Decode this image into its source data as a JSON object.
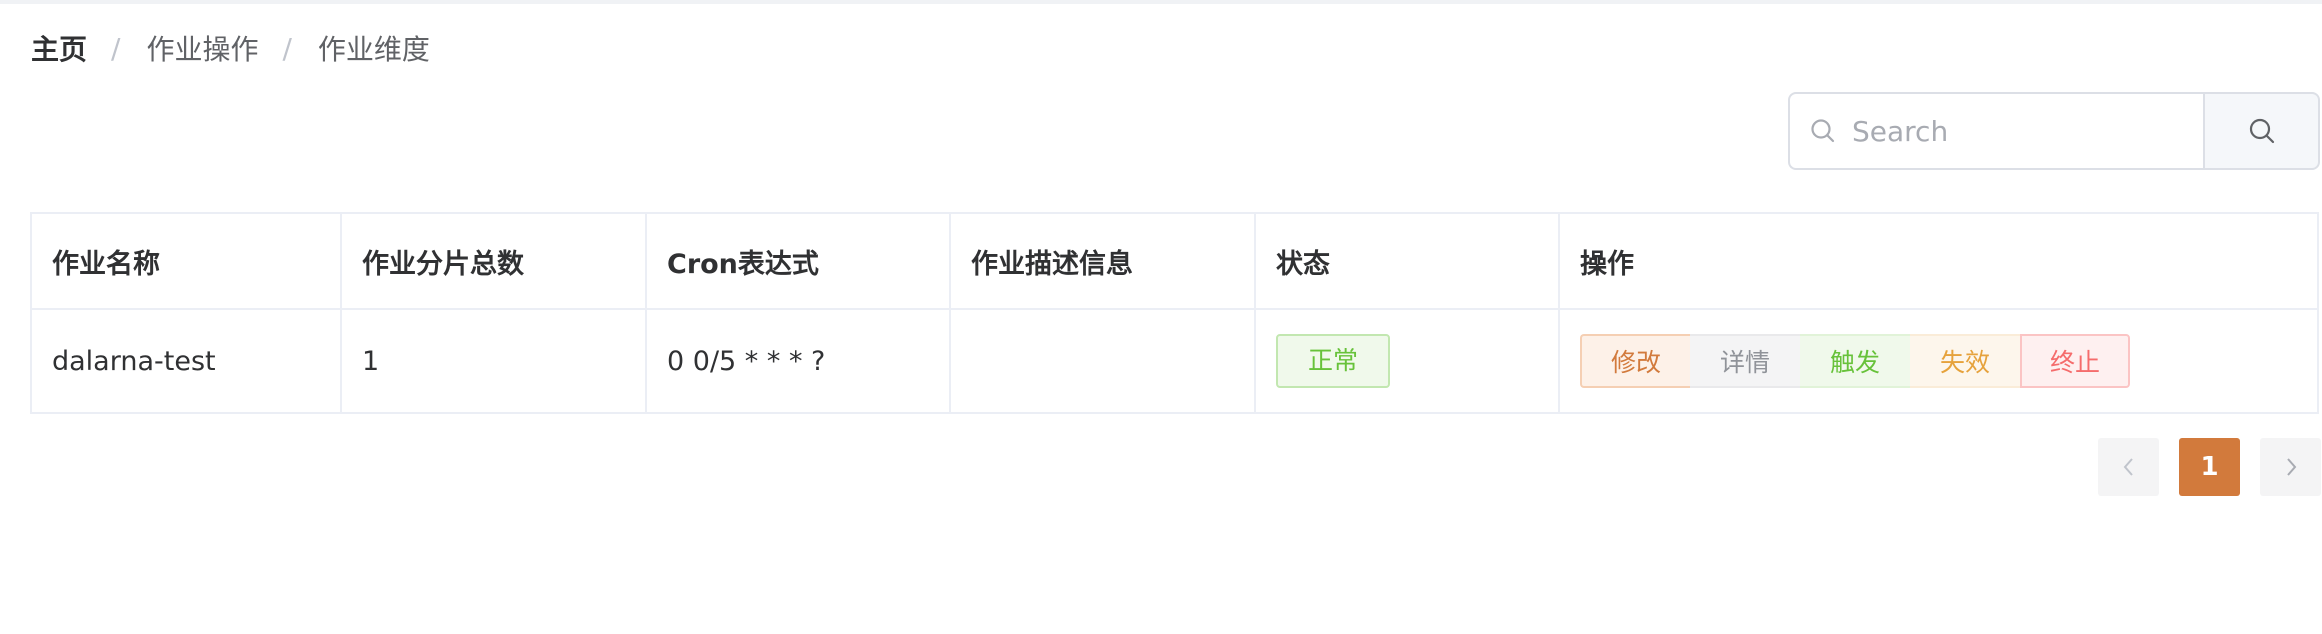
{
  "breadcrumb": {
    "items": [
      "主页",
      "作业操作",
      "作业维度"
    ],
    "separator": "/"
  },
  "search": {
    "placeholder": "Search",
    "value": "",
    "icon": "search-icon",
    "button_icon": "search-icon"
  },
  "table": {
    "columns": [
      "作业名称",
      "作业分片总数",
      "Cron表达式",
      "作业描述信息",
      "状态",
      "操作"
    ],
    "rows": [
      {
        "name": "dalarna-test",
        "sharding": "1",
        "cron": "0 0/5 * * * ?",
        "description": "",
        "status": "正常",
        "actions": [
          "修改",
          "详情",
          "触发",
          "失效",
          "终止"
        ]
      }
    ]
  },
  "pagination": {
    "prev_icon": "chevron-left-icon",
    "next_icon": "chevron-right-icon",
    "current_page": "1"
  },
  "colors": {
    "accent": "#d27a3c",
    "status_ok": "#67c23a",
    "info": "#909399",
    "warning": "#e6a23c",
    "danger": "#f56c6c"
  }
}
